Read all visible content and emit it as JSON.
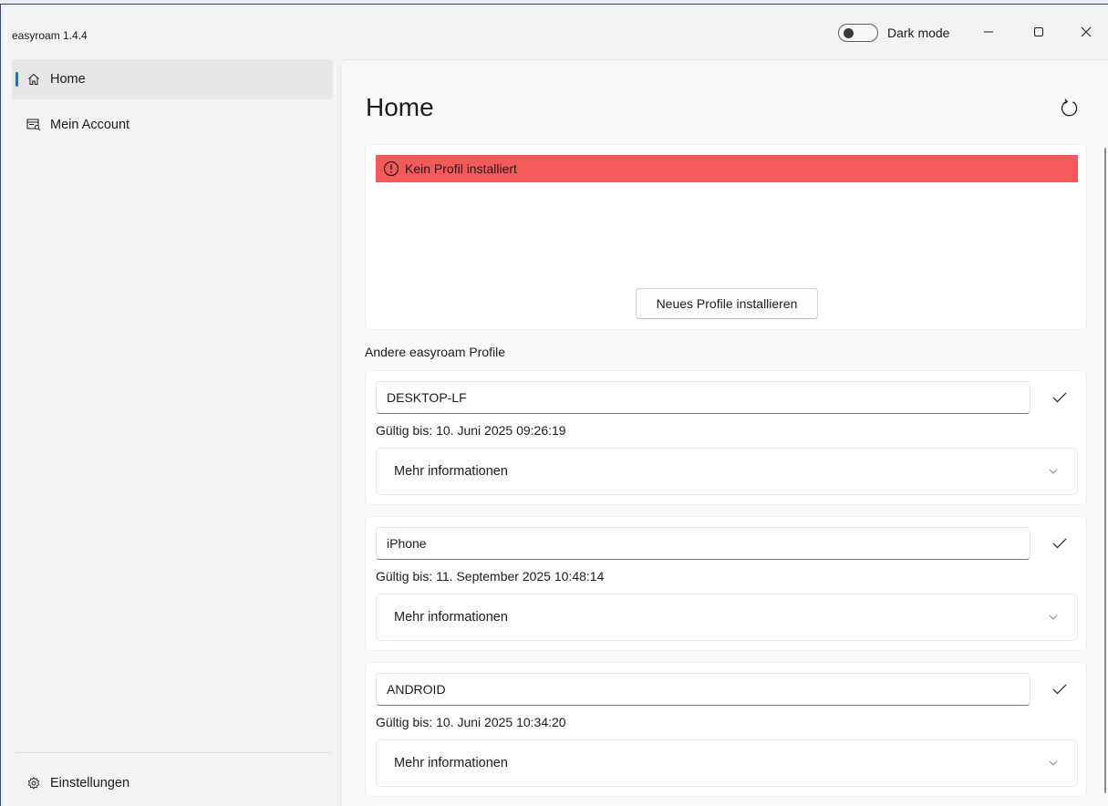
{
  "window": {
    "app_title": "easyroam 1.4.4",
    "dark_mode_label": "Dark mode",
    "minimize_icon": "minimize-icon",
    "maximize_icon": "maximize-icon",
    "close_icon": "close-icon"
  },
  "sidebar": {
    "items": [
      {
        "label": "Home",
        "icon": "home-icon",
        "selected": true
      },
      {
        "label": "Mein Account",
        "icon": "account-icon",
        "selected": false
      }
    ],
    "footer": {
      "label": "Einstellungen",
      "icon": "gear-icon"
    }
  },
  "main": {
    "title": "Home",
    "alert_text": "Kein Profil installiert",
    "install_button": "Neues Profile installieren",
    "section_label": "Andere easyroam Profile",
    "profiles": [
      {
        "name": "DESKTOP-LF",
        "valid": "Gültig bis: 10. Juni 2025 09:26:19",
        "more": "Mehr informationen"
      },
      {
        "name": "iPhone",
        "valid": "Gültig bis: 11. September 2025 10:48:14",
        "more": "Mehr informationen"
      },
      {
        "name": "ANDROID",
        "valid": "Gültig bis: 10. Juni 2025 10:34:20",
        "more": "Mehr informationen"
      }
    ]
  },
  "colors": {
    "accent": "#1f6fce",
    "alert": "#f65a5a"
  }
}
